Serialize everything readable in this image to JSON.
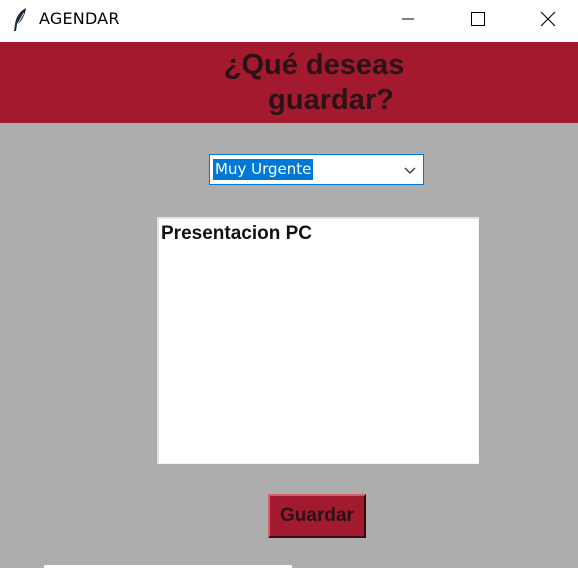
{
  "window": {
    "title": "AGENDAR",
    "icon": "feather-icon"
  },
  "header": {
    "title_line1": "¿Qué deseas",
    "title_line2": "guardar?",
    "background_color": "#a31a2f"
  },
  "priority_select": {
    "selected": "Muy Urgente"
  },
  "note": {
    "text": "Presentacion PC"
  },
  "actions": {
    "save_label": "Guardar"
  },
  "colors": {
    "main_background": "#adadad",
    "accent": "#a31a2f",
    "selection": "#0078d7"
  }
}
